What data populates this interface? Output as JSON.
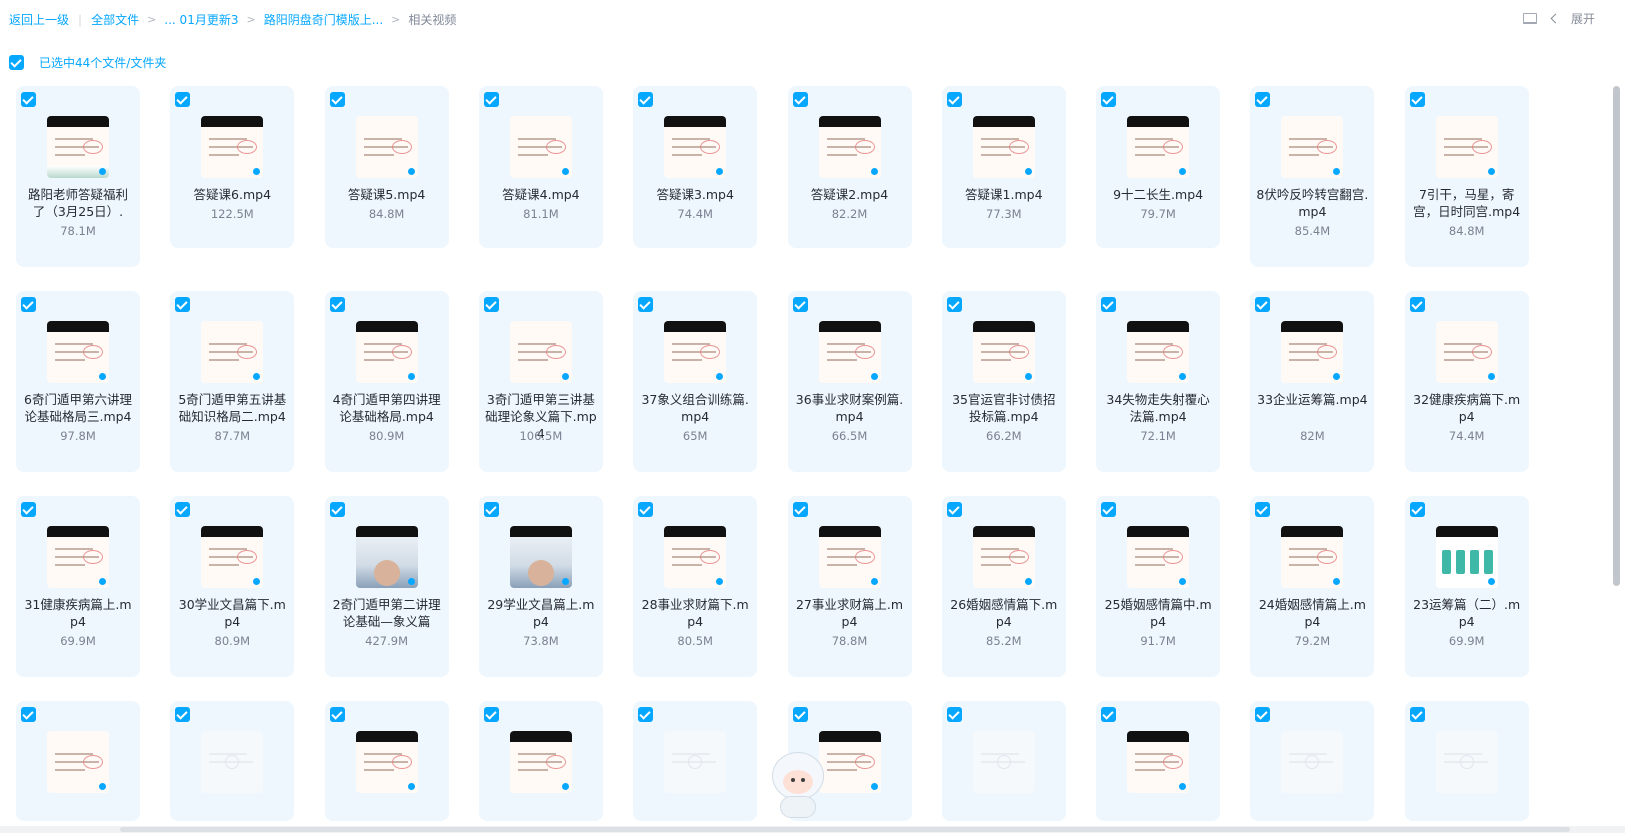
{
  "breadcrumb": {
    "back": "返回上一级",
    "items": [
      "全部文件",
      "... 01月更新3",
      "路阳阴盘奇门模版上...",
      "相关视频"
    ]
  },
  "top_right": {
    "expand_label": "展开"
  },
  "selection": {
    "label": "已选中44个文件/文件夹"
  },
  "accent_color": "#06a7ff",
  "files": [
    {
      "name": "路阳老师答疑福利了（3月25日）.",
      "size": "78.1M"
    },
    {
      "name": "答疑课6.mp4",
      "size": "122.5M"
    },
    {
      "name": "答疑课5.mp4",
      "size": "84.8M"
    },
    {
      "name": "答疑课4.mp4",
      "size": "81.1M"
    },
    {
      "name": "答疑课3.mp4",
      "size": "74.4M"
    },
    {
      "name": "答疑课2.mp4",
      "size": "82.2M"
    },
    {
      "name": "答疑课1.mp4",
      "size": "77.3M"
    },
    {
      "name": "9十二长生.mp4",
      "size": "79.7M"
    },
    {
      "name": "8伏吟反吟转宫翻宫.mp4",
      "size": "85.4M"
    },
    {
      "name": "7引干，马星，寄宫，日时同宫.mp4",
      "size": "84.8M"
    },
    {
      "name": "6奇门遁甲第六讲理论基础格局三.mp4",
      "size": "97.8M"
    },
    {
      "name": "5奇门遁甲第五讲基础知识格局二.mp4",
      "size": "87.7M"
    },
    {
      "name": "4奇门遁甲第四讲理论基础格局.mp4",
      "size": "80.9M"
    },
    {
      "name": "3奇门遁甲第三讲基础理论象义篇下.mp4",
      "size": "106.5M"
    },
    {
      "name": "37象义组合训练篇.mp4",
      "size": "65M"
    },
    {
      "name": "36事业求财案例篇.mp4",
      "size": "66.5M"
    },
    {
      "name": "35官运官非讨债招投标篇.mp4",
      "size": "66.2M"
    },
    {
      "name": "34失物走失射覆心法篇.mp4",
      "size": "72.1M"
    },
    {
      "name": "33企业运筹篇.mp4",
      "size": "82M"
    },
    {
      "name": "32健康疾病篇下.mp4",
      "size": "74.4M"
    },
    {
      "name": "31健康疾病篇上.mp4",
      "size": "69.9M"
    },
    {
      "name": "30学业文昌篇下.mp4",
      "size": "80.9M"
    },
    {
      "name": "2奇门遁甲第二讲理论基础—象义篇",
      "size": "427.9M"
    },
    {
      "name": "29学业文昌篇上.mp4",
      "size": "73.8M"
    },
    {
      "name": "28事业求财篇下.mp4",
      "size": "80.5M"
    },
    {
      "name": "27事业求财篇上.mp4",
      "size": "78.8M"
    },
    {
      "name": "26婚姻感情篇下.mp4",
      "size": "85.2M"
    },
    {
      "name": "25婚姻感情篇中.mp4",
      "size": "91.7M"
    },
    {
      "name": "24婚姻感情篇上.mp4",
      "size": "79.2M"
    },
    {
      "name": "23运筹篇（二）.mp4",
      "size": "69.9M"
    },
    {
      "name": "",
      "size": ""
    },
    {
      "name": "",
      "size": ""
    },
    {
      "name": "",
      "size": ""
    },
    {
      "name": "",
      "size": ""
    },
    {
      "name": "",
      "size": ""
    },
    {
      "name": "",
      "size": ""
    },
    {
      "name": "",
      "size": ""
    },
    {
      "name": "",
      "size": ""
    },
    {
      "name": "",
      "size": ""
    },
    {
      "name": "",
      "size": ""
    }
  ]
}
